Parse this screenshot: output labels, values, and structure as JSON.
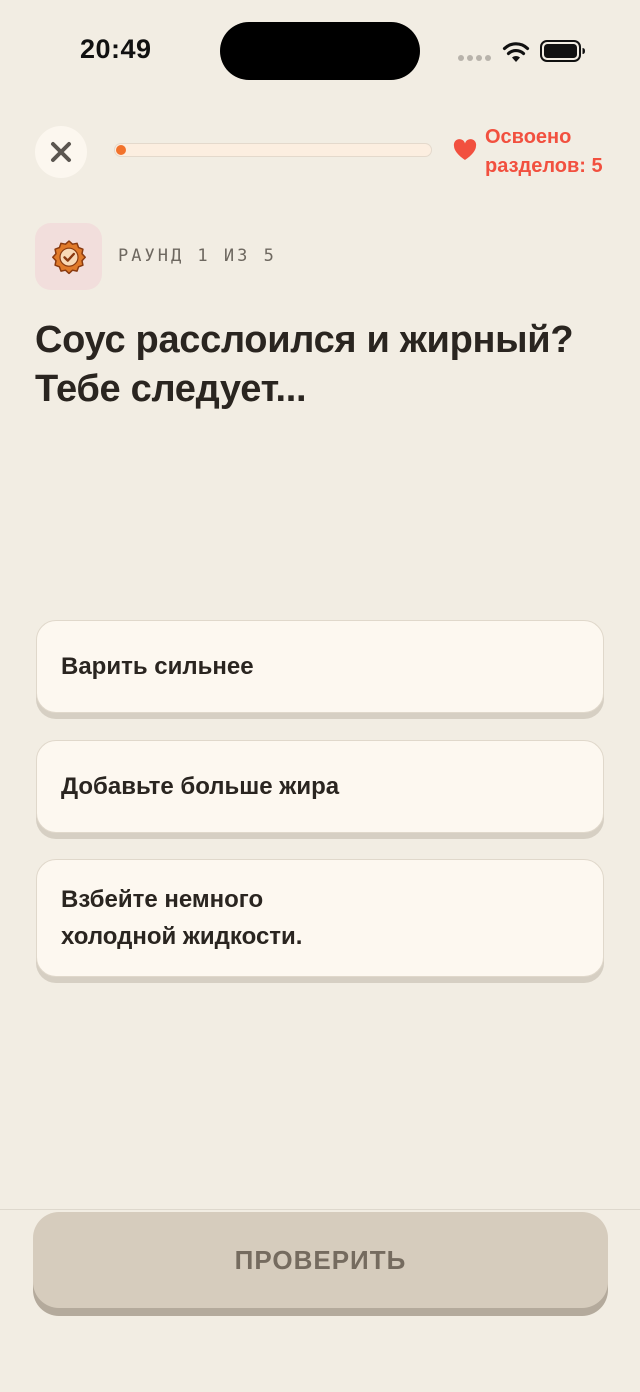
{
  "status_bar": {
    "time": "20:49"
  },
  "header": {
    "progress_percent": 3,
    "mastered_text": "Освоено\nразделов: 5"
  },
  "round": {
    "label": "РАУНД 1 ИЗ 5"
  },
  "question": {
    "title": "Соус расслоился и жирный? Тебе следует..."
  },
  "options": [
    {
      "label": "Варить сильнее"
    },
    {
      "label": "Добавьте больше жира"
    },
    {
      "label": "Взбейте немного холодной жидкости."
    }
  ],
  "footer": {
    "check_label": "ПРОВЕРИТЬ"
  },
  "icons": {
    "close": "close-icon",
    "heart": "heart-icon",
    "badge": "verified-badge-icon",
    "wifi": "wifi-icon",
    "battery": "battery-icon"
  },
  "colors": {
    "background": "#F2EDE3",
    "accent": "#F2722C",
    "mastered": "#F2503F",
    "button_disabled": "#D6CCBD"
  }
}
